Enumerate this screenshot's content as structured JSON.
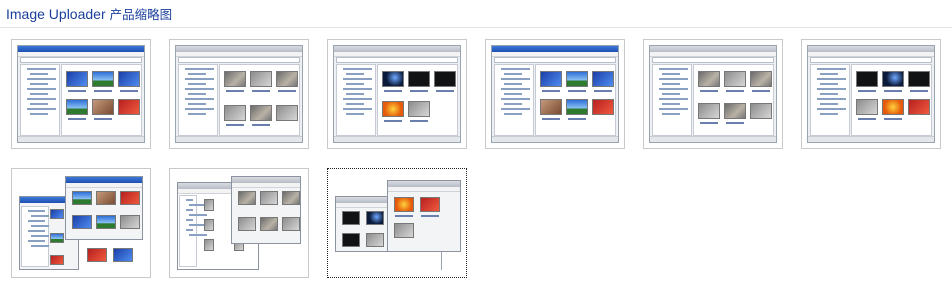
{
  "header": {
    "title_en": "Image Uploader",
    "title_zh": "产品缩略图"
  },
  "accent_color": "#1a3f9c",
  "thumbnails": [
    {
      "name": "thumb-1",
      "style": "xp-blue"
    },
    {
      "name": "thumb-2",
      "style": "classic-grey"
    },
    {
      "name": "thumb-3",
      "style": "mac-dark"
    },
    {
      "name": "thumb-4",
      "style": "xp-blue"
    },
    {
      "name": "thumb-5",
      "style": "classic-grey"
    },
    {
      "name": "thumb-6",
      "style": "mac-dark"
    },
    {
      "name": "thumb-7",
      "style": "xp-stacked"
    },
    {
      "name": "thumb-8",
      "style": "icons-stacked"
    },
    {
      "name": "thumb-9",
      "style": "mac-floating",
      "selected": true
    }
  ]
}
